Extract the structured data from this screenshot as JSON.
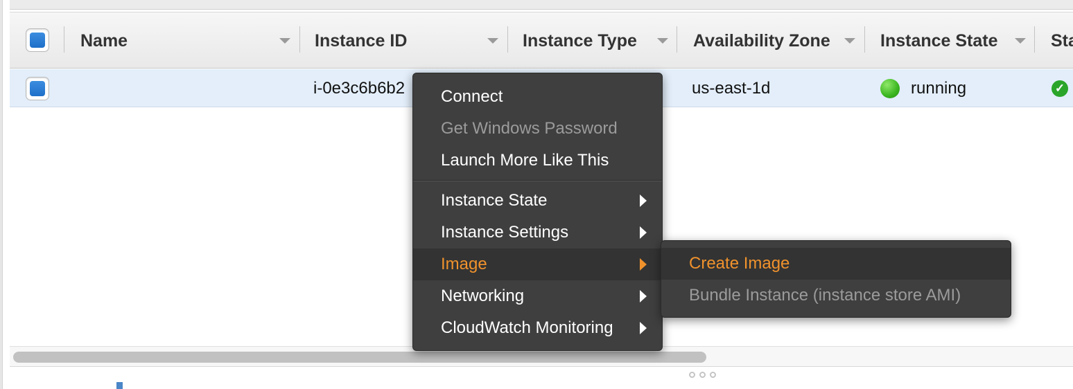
{
  "table": {
    "columns": [
      {
        "label": "Name"
      },
      {
        "label": "Instance ID"
      },
      {
        "label": "Instance Type"
      },
      {
        "label": "Availability Zone"
      },
      {
        "label": "Instance State"
      },
      {
        "label": "Sta"
      }
    ],
    "rows": [
      {
        "name": "",
        "instance_id": "i-0e3c6b6b2",
        "instance_type": "",
        "availability_zone": "us-east-1d",
        "instance_state": "running",
        "status_icon": "check-circle-icon",
        "instance_state_color": "#3ab51f"
      }
    ]
  },
  "context_menu": {
    "items": [
      {
        "label": "Connect",
        "enabled": true
      },
      {
        "label": "Get Windows Password",
        "enabled": false
      },
      {
        "label": "Launch More Like This",
        "enabled": true
      },
      {
        "label": "Instance State",
        "enabled": true,
        "submenu": true
      },
      {
        "label": "Instance Settings",
        "enabled": true,
        "submenu": true
      },
      {
        "label": "Image",
        "enabled": true,
        "submenu": true,
        "highlighted": true
      },
      {
        "label": "Networking",
        "enabled": true,
        "submenu": true
      },
      {
        "label": "CloudWatch Monitoring",
        "enabled": true,
        "submenu": true
      }
    ],
    "highlight_color": "#f0922c"
  },
  "submenu": {
    "items": [
      {
        "label": "Create Image",
        "enabled": true,
        "highlighted": true
      },
      {
        "label": "Bundle Instance (instance store AMI)",
        "enabled": false
      }
    ]
  }
}
